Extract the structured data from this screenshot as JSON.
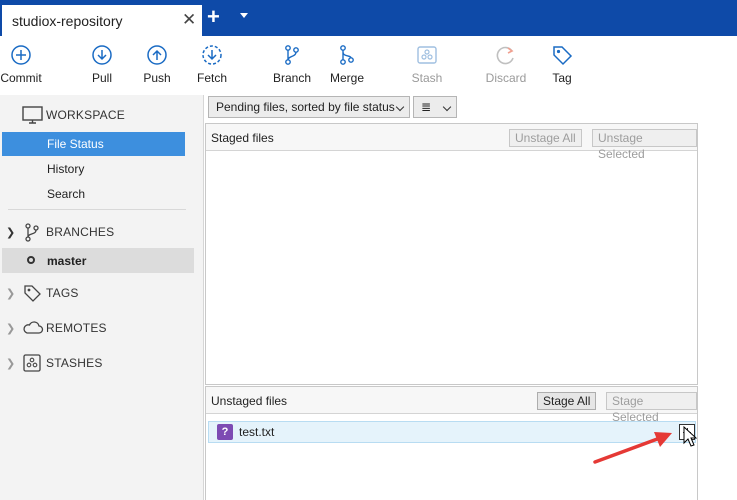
{
  "tab": {
    "title": "studiox-repository"
  },
  "toolbar": {
    "commit": "Commit",
    "pull": "Pull",
    "push": "Push",
    "fetch": "Fetch",
    "branch": "Branch",
    "merge": "Merge",
    "stash": "Stash",
    "discard": "Discard",
    "tag": "Tag"
  },
  "sidebar": {
    "workspace": "WORKSPACE",
    "file_status": "File Status",
    "history": "History",
    "search": "Search",
    "branches": "BRANCHES",
    "current_branch": "master",
    "tags": "TAGS",
    "remotes": "REMOTES",
    "stashes": "STASHES"
  },
  "filter": {
    "sort_mode": "Pending files, sorted by file status",
    "view_icon": "list-icon"
  },
  "staged": {
    "title": "Staged files",
    "unstage_all": "Unstage All",
    "unstage_selected": "Unstage Selected"
  },
  "unstaged": {
    "title": "Unstaged files",
    "stage_all": "Stage All",
    "stage_selected": "Stage Selected",
    "files": [
      {
        "status": "?",
        "name": "test.txt"
      }
    ]
  },
  "colors": {
    "tabbar": "#0e4aa8",
    "accent": "#3d8fde",
    "icon": "#1a6bc4",
    "untracked": "#7d4bb3",
    "annotation": "#e53935"
  }
}
